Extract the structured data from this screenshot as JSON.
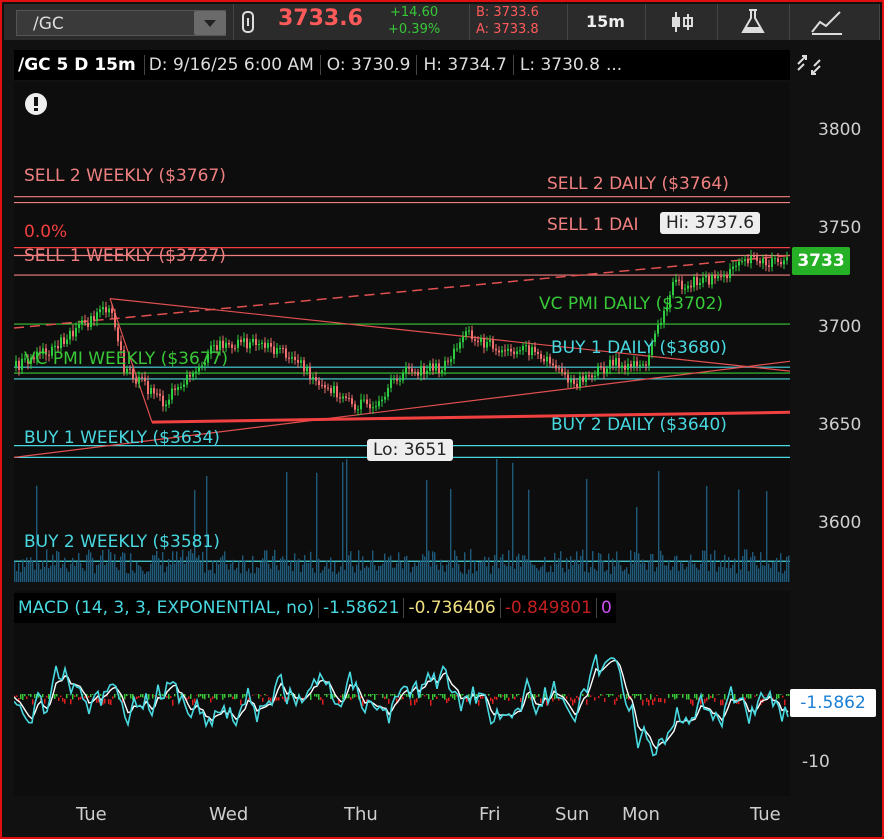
{
  "toolbar": {
    "symbol": "/GC",
    "last": "3733.6",
    "change": "+14.60",
    "change_pct": "+0.39%",
    "bid": "B: 3733.6",
    "ask": "A: 3733.8",
    "timeframe": "15m"
  },
  "header": {
    "symbol": "/GC 5 D 15m",
    "date": "D: 9/16/25 6:00 AM",
    "open": "O: 3730.9",
    "high": "H: 3734.7",
    "low": "L: 3730.8",
    "more": "..."
  },
  "price_axis": [
    "3800",
    "3750",
    "3700",
    "3650",
    "3600"
  ],
  "current_price": "3733",
  "levels": {
    "sell2_weekly": "SELL 2 WEEKLY ($3767)",
    "sell2_daily": "SELL 2 DAILY ($3764)",
    "sell1_daily": "SELL 1 DAI",
    "pct": "0.0%",
    "sell1_weekly": "SELL 1 WEEKLY ($3727)",
    "vcpmi_daily": "VC PMI DAILY ($3702)",
    "vcpmi_weekly": "VC PMI WEEKLY ($3677)",
    "buy1_daily": "BUY 1 DAILY ($3680)",
    "buy2_daily": "BUY 2 DAILY ($3640)",
    "buy1_weekly": "BUY 1 WEEKLY ($3634)",
    "buy2_weekly": "BUY 2 WEEKLY ($3581)"
  },
  "hi_tag": "Hi: 3737.6",
  "lo_tag": "Lo: 3651",
  "macd": {
    "label": "MACD (14, 3, 3, EXPONENTIAL, no)",
    "value": "-1.58621",
    "avg": "-0.736406",
    "diff": "-0.849801",
    "zero": "0",
    "box": "-1.5862",
    "axis_minus10": "-10"
  },
  "x_axis": [
    "Tue",
    "Wed",
    "Thu",
    "Fri",
    "Sun",
    "Mon",
    "Tue"
  ],
  "colors": {
    "up": "#2ecc40",
    "down": "#f07070",
    "cyan": "#48d8e0",
    "level_red": "#f08080",
    "green": "#38c838",
    "border": "#e01010"
  }
}
